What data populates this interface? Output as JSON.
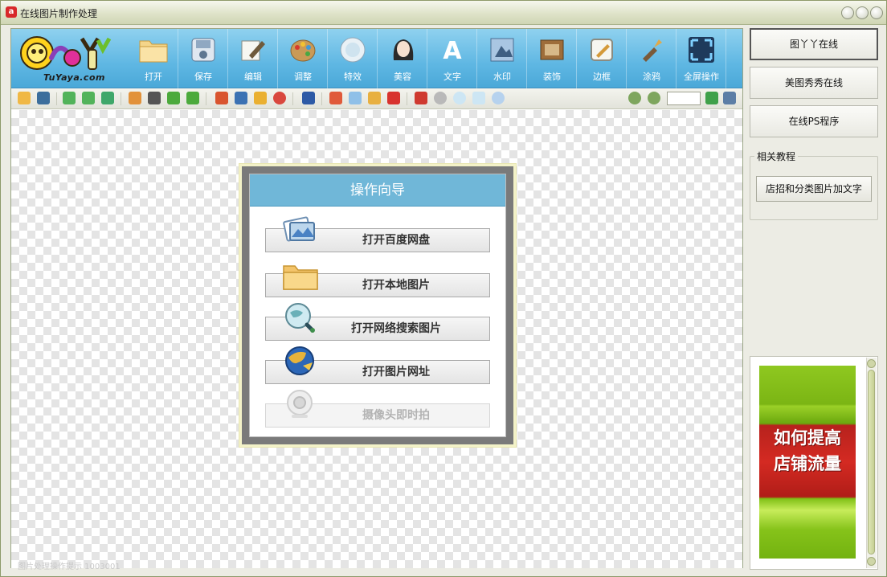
{
  "window": {
    "title": "在线图片制作处理"
  },
  "logo": {
    "text": "TuYaya.com"
  },
  "toolbar": {
    "tools": [
      {
        "label": "打开",
        "icon": "folder-icon"
      },
      {
        "label": "保存",
        "icon": "save-disk-icon"
      },
      {
        "label": "编辑",
        "icon": "edit-pen-icon"
      },
      {
        "label": "调整",
        "icon": "palette-icon"
      },
      {
        "label": "特效",
        "icon": "effects-sphere-icon"
      },
      {
        "label": "美容",
        "icon": "face-beauty-icon"
      },
      {
        "label": "文字",
        "icon": "text-a-icon"
      },
      {
        "label": "水印",
        "icon": "watermark-icon"
      },
      {
        "label": "装饰",
        "icon": "decoration-frame-icon"
      },
      {
        "label": "边框",
        "icon": "border-icon"
      },
      {
        "label": "涂鸦",
        "icon": "brush-icon"
      },
      {
        "label": "全屏操作",
        "icon": "fullscreen-icon"
      }
    ]
  },
  "canvas": {
    "status_text": "图片处理操作提示 1003001"
  },
  "wizard": {
    "title": "操作向导",
    "options": [
      {
        "label": "打开百度网盘",
        "icon": "cloud-disk-icon",
        "enabled": true
      },
      {
        "label": "打开本地图片",
        "icon": "folder-icon",
        "enabled": true
      },
      {
        "label": "打开网络搜索图片",
        "icon": "globe-search-icon",
        "enabled": true
      },
      {
        "label": "打开图片网址",
        "icon": "globe-link-icon",
        "enabled": true
      },
      {
        "label": "摄像头即时拍",
        "icon": "webcam-icon",
        "enabled": false
      }
    ]
  },
  "sidebar": {
    "buttons": [
      {
        "label": "图丫丫在线",
        "active": true
      },
      {
        "label": "美图秀秀在线",
        "active": false
      },
      {
        "label": "在线PS程序",
        "active": false
      }
    ],
    "tutorials_title": "相关教程",
    "tutorial_button": "店招和分类图片加文字",
    "ad": {
      "line1": "如何提高",
      "line2": "店铺流量"
    }
  },
  "colors": {
    "toolbar": "#5fb7e3",
    "wizard_header": "#70b7d8",
    "ad_red": "#d42a22",
    "ad_green": "#8fc820"
  }
}
